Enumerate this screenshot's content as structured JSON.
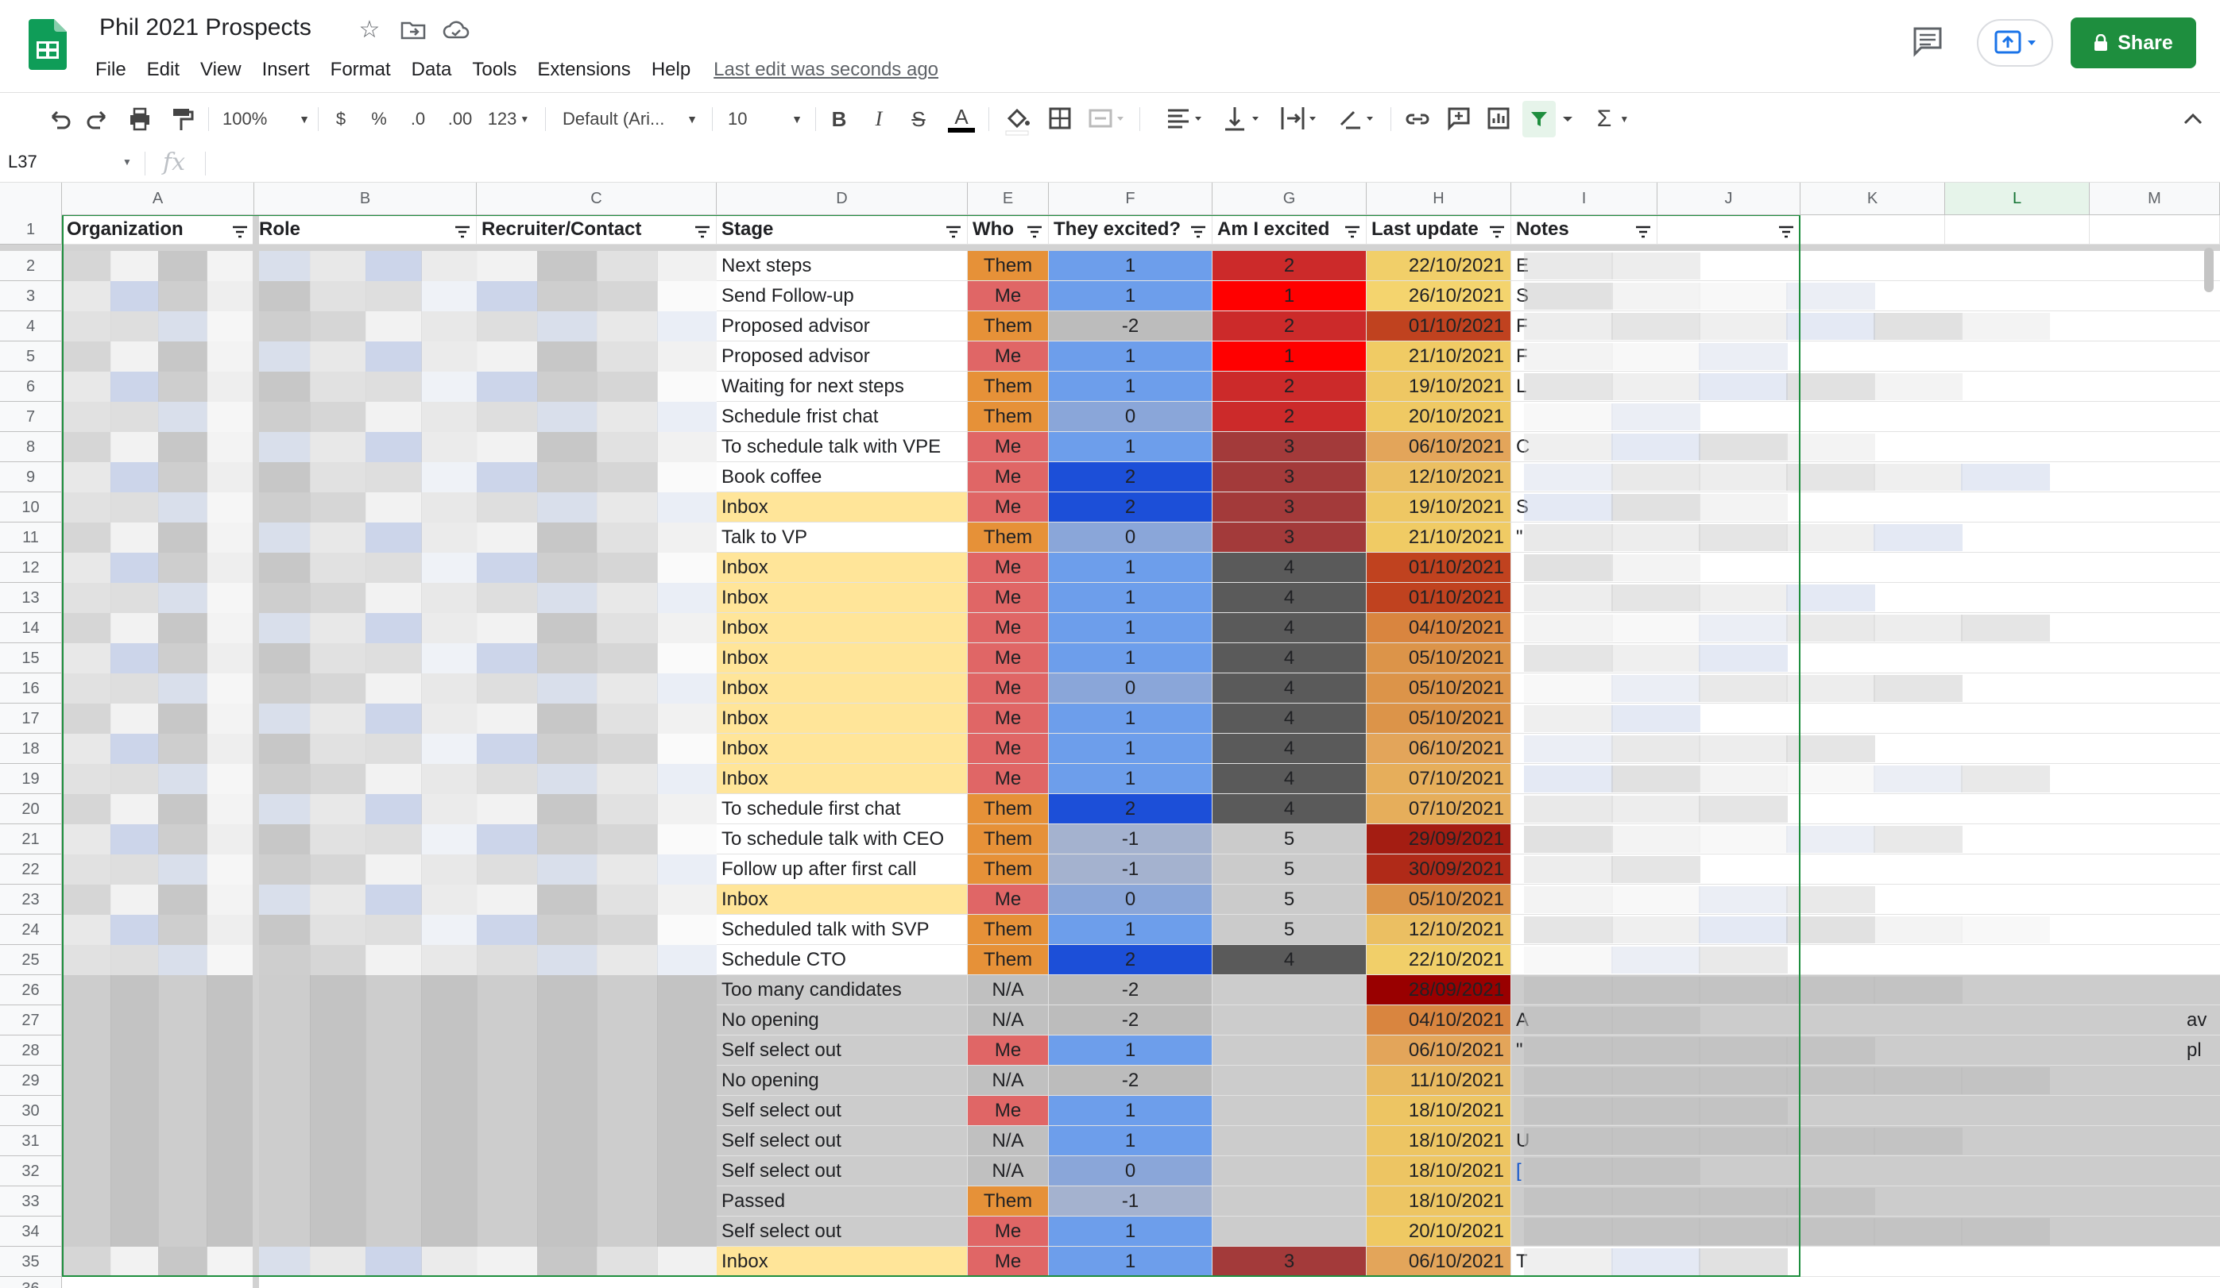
{
  "app": {
    "title": "Phil 2021 Prospects",
    "menu": [
      "File",
      "Edit",
      "View",
      "Insert",
      "Format",
      "Data",
      "Tools",
      "Extensions",
      "Help"
    ],
    "last_edit": "Last edit was seconds ago",
    "share_label": "Share",
    "brand_color": "#1e8e3e"
  },
  "toolbar": {
    "zoom": "100%",
    "currency": "$",
    "percent": "%",
    "decimal_less": ".0",
    "decimal_more": ".00",
    "format_more": "123",
    "font": "Default (Ari...",
    "font_size": "10",
    "bold": "B",
    "italic": "I",
    "strikethrough": "S",
    "text_color": "A",
    "sum": "Σ"
  },
  "formula_bar": {
    "cell_ref": "L37",
    "fx": "fx"
  },
  "columns": [
    "A",
    "B",
    "C",
    "D",
    "E",
    "F",
    "G",
    "H",
    "I",
    "J",
    "K",
    "L",
    "M"
  ],
  "header_row": [
    "Organization",
    "Role",
    "Recruiter/Contact",
    "Stage",
    "Who",
    "They excited?",
    "Am I excited",
    "Last update",
    "Notes",
    ""
  ],
  "rows": [
    {
      "n": "2",
      "stage": "Next steps",
      "who": "Them",
      "they": "1",
      "me": "2",
      "date": "22/10/2021",
      "note": "E"
    },
    {
      "n": "3",
      "stage": "Send Follow-up",
      "who": "Me",
      "they": "1",
      "me": "1",
      "date": "26/10/2021",
      "note": "S"
    },
    {
      "n": "4",
      "stage": "Proposed advisor",
      "who": "Them",
      "they": "-2",
      "me": "2",
      "date": "01/10/2021",
      "note": "F"
    },
    {
      "n": "5",
      "stage": "Proposed advisor",
      "who": "Me",
      "they": "1",
      "me": "1",
      "date": "21/10/2021",
      "note": "F"
    },
    {
      "n": "6",
      "stage": "Waiting for next steps",
      "who": "Them",
      "they": "1",
      "me": "2",
      "date": "19/10/2021",
      "note": "L"
    },
    {
      "n": "7",
      "stage": "Schedule frist chat",
      "who": "Them",
      "they": "0",
      "me": "2",
      "date": "20/10/2021",
      "note": ""
    },
    {
      "n": "8",
      "stage": "To schedule talk with VPE",
      "who": "Me",
      "they": "1",
      "me": "3",
      "date": "06/10/2021",
      "note": "C"
    },
    {
      "n": "9",
      "stage": "Book coffee",
      "who": "Me",
      "they": "2",
      "me": "3",
      "date": "12/10/2021",
      "note": ""
    },
    {
      "n": "10",
      "stage": "Inbox",
      "who": "Me",
      "they": "2",
      "me": "3",
      "date": "19/10/2021",
      "note": "S"
    },
    {
      "n": "11",
      "stage": "Talk to VP",
      "who": "Them",
      "they": "0",
      "me": "3",
      "date": "21/10/2021",
      "note": "\""
    },
    {
      "n": "12",
      "stage": "Inbox",
      "who": "Me",
      "they": "1",
      "me": "4",
      "date": "01/10/2021",
      "note": ""
    },
    {
      "n": "13",
      "stage": "Inbox",
      "who": "Me",
      "they": "1",
      "me": "4",
      "date": "01/10/2021",
      "note": ""
    },
    {
      "n": "14",
      "stage": "Inbox",
      "who": "Me",
      "they": "1",
      "me": "4",
      "date": "04/10/2021",
      "note": ""
    },
    {
      "n": "15",
      "stage": "Inbox",
      "who": "Me",
      "they": "1",
      "me": "4",
      "date": "05/10/2021",
      "note": ""
    },
    {
      "n": "16",
      "stage": "Inbox",
      "who": "Me",
      "they": "0",
      "me": "4",
      "date": "05/10/2021",
      "note": ""
    },
    {
      "n": "17",
      "stage": "Inbox",
      "who": "Me",
      "they": "1",
      "me": "4",
      "date": "05/10/2021",
      "note": ""
    },
    {
      "n": "18",
      "stage": "Inbox",
      "who": "Me",
      "they": "1",
      "me": "4",
      "date": "06/10/2021",
      "note": ""
    },
    {
      "n": "19",
      "stage": "Inbox",
      "who": "Me",
      "they": "1",
      "me": "4",
      "date": "07/10/2021",
      "note": ""
    },
    {
      "n": "20",
      "stage": "To schedule first chat",
      "who": "Them",
      "they": "2",
      "me": "4",
      "date": "07/10/2021",
      "note": ""
    },
    {
      "n": "21",
      "stage": "To schedule talk with CEO",
      "who": "Them",
      "they": "-1",
      "me": "5",
      "date": "29/09/2021",
      "note": ""
    },
    {
      "n": "22",
      "stage": "Follow up after first call",
      "who": "Them",
      "they": "-1",
      "me": "5",
      "date": "30/09/2021",
      "note": ""
    },
    {
      "n": "23",
      "stage": "Inbox",
      "who": "Me",
      "they": "0",
      "me": "5",
      "date": "05/10/2021",
      "note": ""
    },
    {
      "n": "24",
      "stage": "Scheduled talk with SVP",
      "who": "Them",
      "they": "1",
      "me": "5",
      "date": "12/10/2021",
      "note": ""
    },
    {
      "n": "25",
      "stage": "Schedule CTO",
      "who": "Them",
      "they": "2",
      "me": "4",
      "date": "22/10/2021",
      "note": ""
    },
    {
      "n": "26",
      "stage": "Too many candidates",
      "who": "N/A",
      "they": "-2",
      "me": "",
      "date": "28/09/2021",
      "note": ""
    },
    {
      "n": "27",
      "stage": "No opening",
      "who": "N/A",
      "they": "-2",
      "me": "",
      "date": "04/10/2021",
      "note": "A"
    },
    {
      "n": "28",
      "stage": "Self select out",
      "who": "Me",
      "they": "1",
      "me": "",
      "date": "06/10/2021",
      "note": "\""
    },
    {
      "n": "29",
      "stage": "No opening",
      "who": "N/A",
      "they": "-2",
      "me": "",
      "date": "11/10/2021",
      "note": ""
    },
    {
      "n": "30",
      "stage": "Self select out",
      "who": "Me",
      "they": "1",
      "me": "",
      "date": "18/10/2021",
      "note": ""
    },
    {
      "n": "31",
      "stage": "Self select out",
      "who": "N/A",
      "they": "1",
      "me": "",
      "date": "18/10/2021",
      "note": "U"
    },
    {
      "n": "32",
      "stage": "Self select out",
      "who": "N/A",
      "they": "0",
      "me": "",
      "date": "18/10/2021",
      "note": "["
    },
    {
      "n": "33",
      "stage": "Passed",
      "who": "Them",
      "they": "-1",
      "me": "",
      "date": "18/10/2021",
      "note": ""
    },
    {
      "n": "34",
      "stage": "Self select out",
      "who": "Me",
      "they": "1",
      "me": "",
      "date": "20/10/2021",
      "note": ""
    },
    {
      "n": "35",
      "stage": "Inbox",
      "who": "Me",
      "they": "1",
      "me": "3",
      "date": "06/10/2021",
      "note": "T"
    }
  ],
  "overflow_text": {
    "row27": "av",
    "row28": "pl"
  },
  "row_36": "36"
}
